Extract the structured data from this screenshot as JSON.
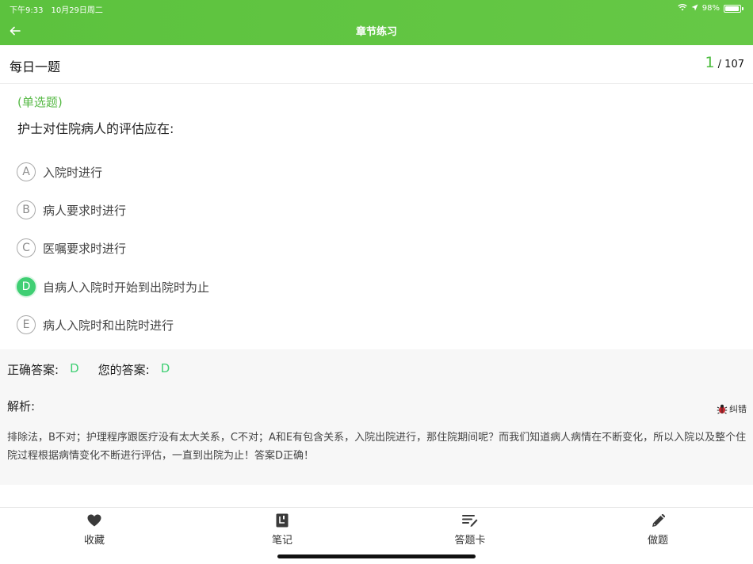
{
  "status_bar": {
    "time": "下午9:33",
    "date": "10月29日周二",
    "battery": "98%"
  },
  "nav": {
    "title": "章节练习"
  },
  "header": {
    "title": "每日一题",
    "current": "1",
    "total": "/ 107"
  },
  "question": {
    "type": "(单选题)",
    "text": "护士对住院病人的评估应在:",
    "options": [
      {
        "letter": "A",
        "text": "入院时进行"
      },
      {
        "letter": "B",
        "text": "病人要求时进行"
      },
      {
        "letter": "C",
        "text": "医嘱要求时进行"
      },
      {
        "letter": "D",
        "text": "自病人入院时开始到出院时为止"
      },
      {
        "letter": "E",
        "text": "病人入院时和出院时进行"
      }
    ],
    "selected": "D"
  },
  "analysis": {
    "correct_label": "正确答案:",
    "correct_value": "D",
    "your_label": "您的答案:",
    "your_value": "D",
    "label": "解析:",
    "report_label": "纠错",
    "text": "排除法，B不对；护理程序跟医疗没有太大关系，C不对；A和E有包含关系，入院出院进行，那住院期间呢？而我们知道病人病情在不断变化，所以入院以及整个住院过程根据病情变化不断进行评估，一直到出院为止！答案D正确！"
  },
  "tabs": [
    {
      "label": "收藏",
      "icon": "heart-icon"
    },
    {
      "label": "笔记",
      "icon": "note-icon"
    },
    {
      "label": "答题卡",
      "icon": "answer-card-icon"
    },
    {
      "label": "做题",
      "icon": "pencil-icon"
    }
  ],
  "colors": {
    "brand": "#5cc23e",
    "selected": "#3fcf73",
    "analysis_bg": "#f7f7f7"
  }
}
